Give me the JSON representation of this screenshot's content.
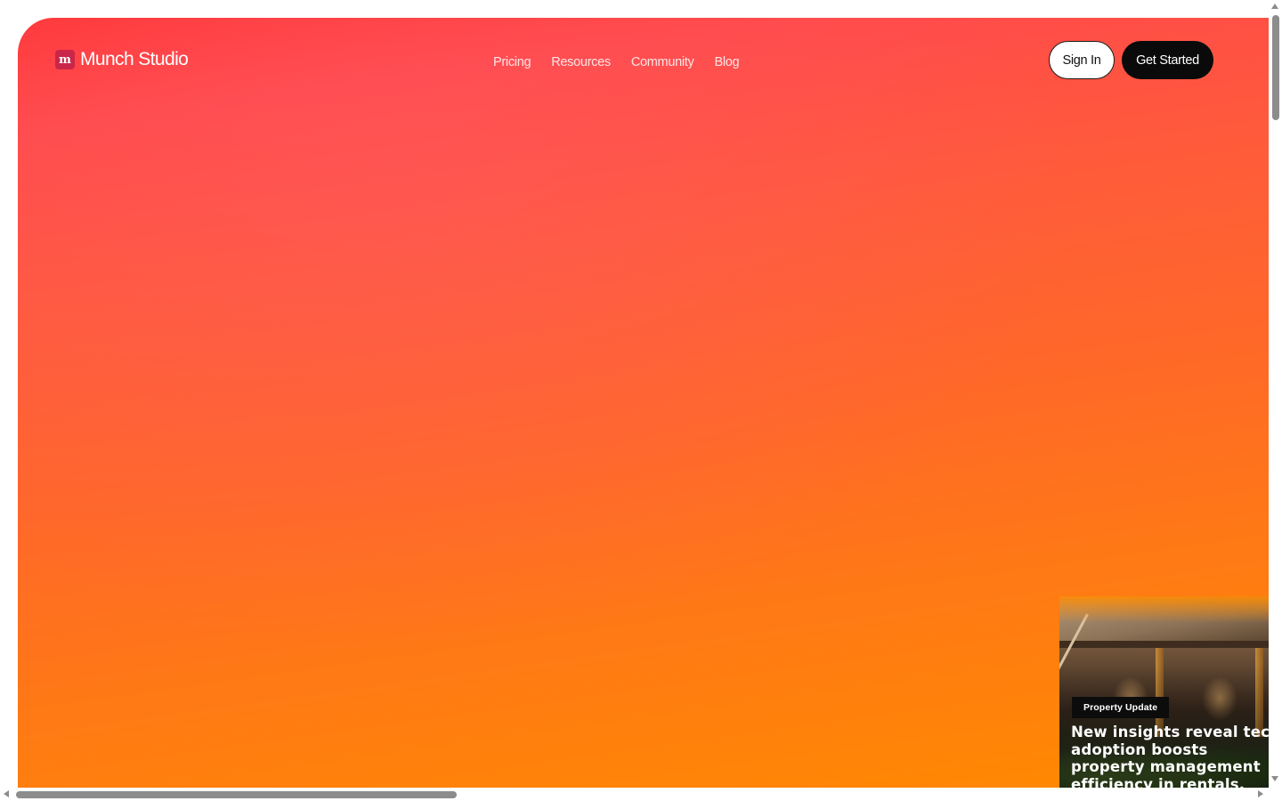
{
  "brand": {
    "name": "Munch Studio",
    "mark": "m",
    "mark_color": "#c9264a"
  },
  "nav": {
    "links": [
      {
        "label": "Pricing"
      },
      {
        "label": "Resources"
      },
      {
        "label": "Community"
      },
      {
        "label": "Blog"
      }
    ],
    "sign_in_label": "Sign In",
    "get_started_label": "Get Started"
  },
  "hero": {
    "gradient_top": "#ff3535",
    "gradient_bottom": "#ff8a00"
  },
  "card": {
    "badge": "Property Update",
    "title": "New insights reveal tech adoption boosts property management efficiency in rentals.",
    "image_icon": "house-porch-photo"
  },
  "scrollbars": {
    "vertical_position": 0,
    "horizontal_position": 0
  }
}
